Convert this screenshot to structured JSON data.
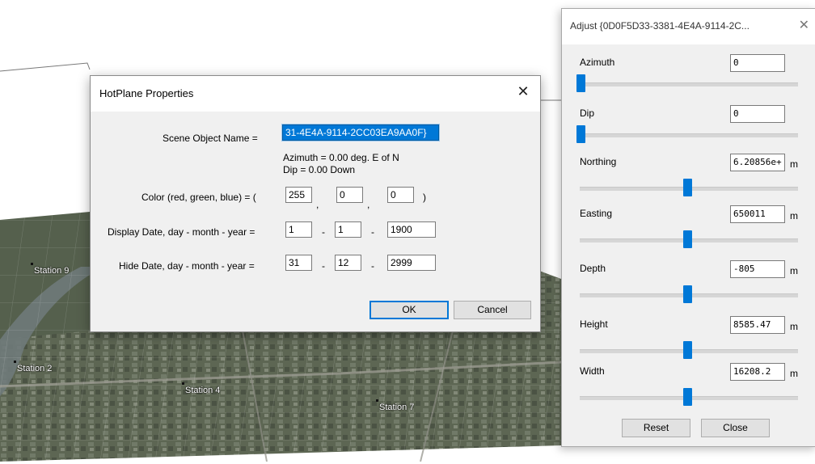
{
  "background_stations": [
    {
      "label": "Station 9"
    },
    {
      "label": "Station 2"
    },
    {
      "label": "Station 4"
    },
    {
      "label": "Station 7"
    }
  ],
  "hotplane_dialog": {
    "title": "HotPlane Properties",
    "close_glyph": "✕",
    "scene_object_name_label": "Scene Object Name =",
    "scene_object_name_value": "31-4E4A-9114-2CC03EA9AA0F}",
    "azimuth_line": "Azimuth =  0.00 deg. E of N",
    "dip_line": "Dip =  0.00 Down",
    "color_label": "Color (red, green, blue) = (",
    "color_values": [
      "255",
      "0",
      "0"
    ],
    "color_close": ")",
    "display_date_label": "Display Date, day - month - year =",
    "display_date": [
      "1",
      "1",
      "1900"
    ],
    "hide_date_label": "Hide Date, day - month - year =",
    "hide_date": [
      "31",
      "12",
      "2999"
    ],
    "ok_label": "OK",
    "cancel_label": "Cancel"
  },
  "adjust_panel": {
    "title": "Adjust {0D0F5D33-3381-4E4A-9114-2C...",
    "close_glyph": "✕",
    "fields": [
      {
        "label": "Azimuth",
        "value": "0",
        "unit": "",
        "slider_level": 0.0
      },
      {
        "label": "Dip",
        "value": "0",
        "unit": "",
        "slider_level": 0.0
      },
      {
        "label": "Northing",
        "value": "6.20856e+",
        "unit": "m",
        "slider_level": 0.5
      },
      {
        "label": "Easting",
        "value": "650011",
        "unit": "m",
        "slider_level": 0.5
      },
      {
        "label": "Depth",
        "value": "-805",
        "unit": "m",
        "slider_level": 0.5
      },
      {
        "label": "Height",
        "value": "8585.47",
        "unit": "m",
        "slider_level": 0.5
      },
      {
        "label": "Width",
        "value": "16208.2",
        "unit": "m",
        "slider_level": 0.5
      }
    ],
    "reset_label": "Reset",
    "close_label": "Close"
  }
}
